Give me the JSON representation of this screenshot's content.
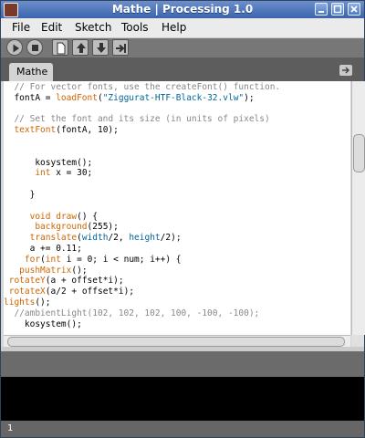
{
  "window": {
    "title": "Mathe | Processing 1.0"
  },
  "menu": {
    "items": [
      "File",
      "Edit",
      "Sketch",
      "Tools",
      "Help"
    ]
  },
  "tabs": [
    {
      "label": "Mathe"
    }
  ],
  "status": {
    "line_number": "1"
  },
  "icons": {
    "titlebar": [
      "app-icon",
      "minimize-icon",
      "maximize-icon",
      "close-icon"
    ],
    "toolbar": [
      "run-icon",
      "stop-icon",
      "new-icon",
      "open-icon",
      "save-icon",
      "export-icon"
    ],
    "tab": [
      "tab-menu-arrow-icon"
    ]
  },
  "code_lines": [
    "  // For vector fonts, use the createFont() function.",
    "  fontA = loadFont(\"Ziggurat-HTF-Black-32.vlw\");",
    "",
    "  // Set the font and its size (in units of pixels)",
    "  textFont(fontA, 10);",
    "",
    "",
    "      kosystem();",
    "      int x = 30;",
    "",
    "     }",
    "",
    "     void draw() {",
    "      background(255);",
    "     translate(width/2, height/2);",
    "     a += 0.11;",
    "    for(int i = 0; i < num; i++) {",
    "   pushMatrix();",
    " rotateY(a + offset*i);",
    " rotateX(a/2 + offset*i);",
    "lights();",
    "  //ambientLight(102, 102, 102, 100, -100, -100);",
    "    kosystem();"
  ]
}
